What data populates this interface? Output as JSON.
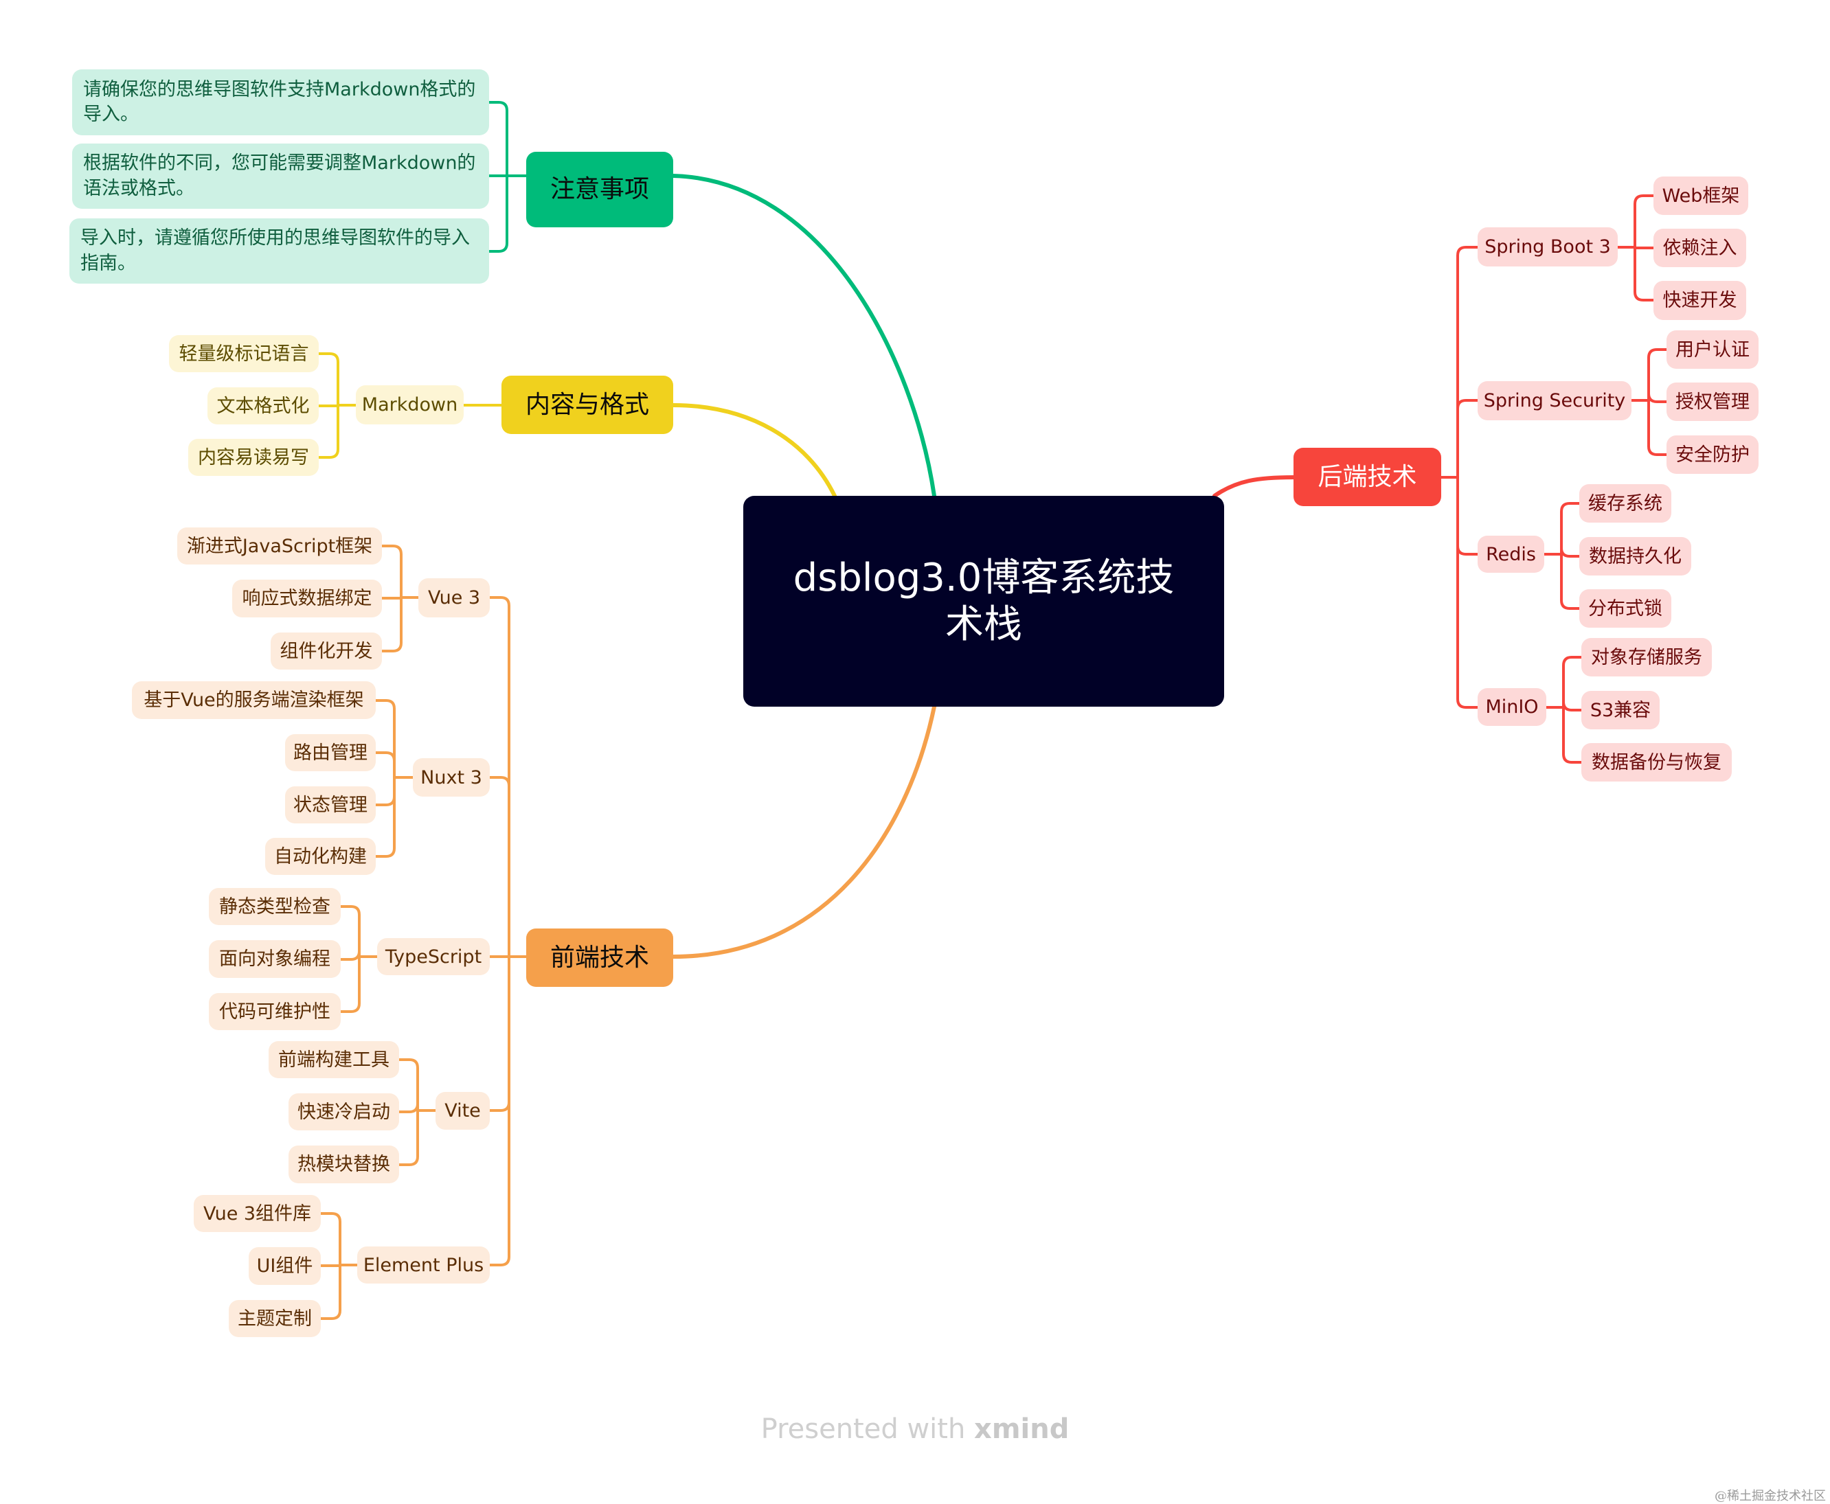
{
  "root": {
    "title": "dsblog3.0博客系统技术栈"
  },
  "colors": {
    "green": "#00bb7a",
    "yellow": "#f0d11e",
    "orange": "#f5a04b",
    "red": "#f7453c",
    "root": "#010127"
  },
  "branches": {
    "notes": {
      "label": "注意事项",
      "items": [
        "请确保您的思维导图软件支持Markdown格式的导入。",
        "根据软件的不同，您可能需要调整Markdown的语法或格式。",
        "导入时，请遵循您所使用的思维导图软件的导入指南。"
      ]
    },
    "content": {
      "label": "内容与格式",
      "children": [
        {
          "label": "Markdown",
          "children": [
            "轻量级标记语言",
            "文本格式化",
            "内容易读易写"
          ]
        }
      ]
    },
    "frontend": {
      "label": "前端技术",
      "children": [
        {
          "label": "Vue 3",
          "children": [
            "渐进式JavaScript框架",
            "响应式数据绑定",
            "组件化开发"
          ]
        },
        {
          "label": "Nuxt 3",
          "children": [
            "基于Vue的服务端渲染框架",
            "路由管理",
            "状态管理",
            "自动化构建"
          ]
        },
        {
          "label": "TypeScript",
          "children": [
            "静态类型检查",
            "面向对象编程",
            "代码可维护性"
          ]
        },
        {
          "label": "Vite",
          "children": [
            "前端构建工具",
            "快速冷启动",
            "热模块替换"
          ]
        },
        {
          "label": "Element Plus",
          "children": [
            "Vue 3组件库",
            "UI组件",
            "主题定制"
          ]
        }
      ]
    },
    "backend": {
      "label": "后端技术",
      "children": [
        {
          "label": "Spring Boot 3",
          "children": [
            "Web框架",
            "依赖注入",
            "快速开发"
          ]
        },
        {
          "label": "Spring Security",
          "children": [
            "用户认证",
            "授权管理",
            "安全防护"
          ]
        },
        {
          "label": "Redis",
          "children": [
            "缓存系统",
            "数据持久化",
            "分布式锁"
          ]
        },
        {
          "label": "MinIO",
          "children": [
            "对象存储服务",
            "S3兼容",
            "数据备份与恢复"
          ]
        }
      ]
    }
  },
  "footer": {
    "prefix": "Presented with ",
    "brand": "xmind"
  },
  "watermark": "@稀土掘金技术社区"
}
